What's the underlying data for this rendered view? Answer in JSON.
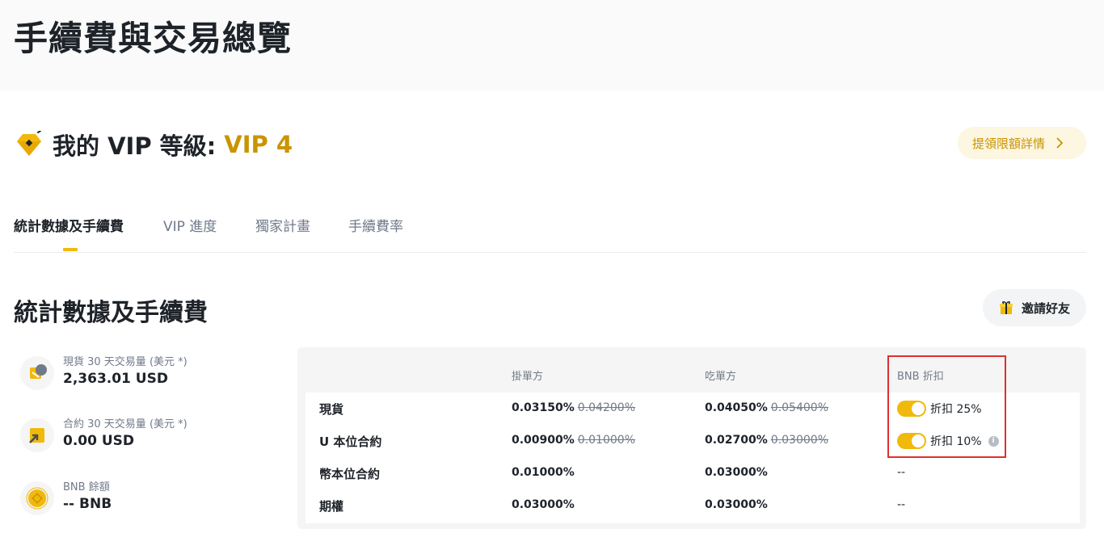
{
  "page": {
    "title": "手續費與交易總覽"
  },
  "vip": {
    "label": "我的 VIP 等級:",
    "level": "VIP 4",
    "limit_button": "提領限額詳情"
  },
  "tabs": [
    {
      "label": "統計數據及手續費",
      "active": true
    },
    {
      "label": "VIP 進度",
      "active": false
    },
    {
      "label": "獨家計畫",
      "active": false
    },
    {
      "label": "手續費率",
      "active": false
    }
  ],
  "section": {
    "title": "統計數據及手續費",
    "invite_button": "邀請好友"
  },
  "stats": [
    {
      "label": "現貨 30 天交易量 (美元 *)",
      "value": "2,363.01 USD",
      "icon": "spot-volume-icon"
    },
    {
      "label": "合約 30 天交易量 (美元 *)",
      "value": "0.00 USD",
      "icon": "futures-volume-icon"
    },
    {
      "label": "BNB 餘額",
      "value": "-- BNB",
      "icon": "bnb-coin-icon"
    }
  ],
  "fee_table": {
    "headers": {
      "maker": "掛單方",
      "taker": "吃單方",
      "bnb": "BNB 折扣"
    },
    "rows": [
      {
        "label": "現貨",
        "maker": "0.03150%",
        "maker_old": "0.04200%",
        "taker": "0.04050%",
        "taker_old": "0.05400%",
        "bnb": "折扣 25%",
        "bnb_enabled": true
      },
      {
        "label": "U 本位合約",
        "maker": "0.00900%",
        "maker_old": "0.01000%",
        "taker": "0.02700%",
        "taker_old": "0.03000%",
        "bnb": "折扣 10%",
        "bnb_enabled": true
      },
      {
        "label": "幣本位合約",
        "maker": "0.01000%",
        "taker": "0.03000%",
        "bnb": "--"
      },
      {
        "label": "期權",
        "maker": "0.03000%",
        "taker": "0.03000%",
        "bnb": "--"
      }
    ]
  },
  "colors": {
    "accent": "#f0b90b",
    "vip_gold": "#c99400",
    "highlight": "#e02f2f"
  }
}
